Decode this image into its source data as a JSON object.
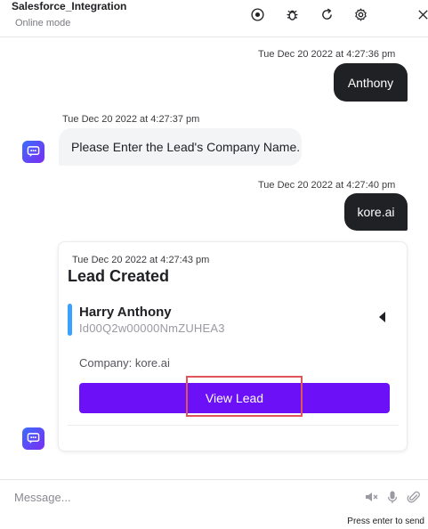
{
  "header": {
    "bot_name": "Salesforce_Integration",
    "status": "Online mode",
    "icons": [
      "record-icon",
      "bug-icon",
      "refresh-icon",
      "settings-icon",
      "close-icon"
    ]
  },
  "messages": {
    "m1": {
      "sender": "user",
      "timestamp": "Tue Dec 20 2022 at 4:27:36 pm",
      "text": "Anthony"
    },
    "m2": {
      "sender": "bot",
      "timestamp": "Tue Dec 20 2022 at 4:27:37 pm",
      "text": "Please Enter the Lead's Company Name."
    },
    "m3": {
      "sender": "user",
      "timestamp": "Tue Dec 20 2022 at 4:27:40 pm",
      "text": "kore.ai"
    }
  },
  "card": {
    "timestamp": "Tue Dec 20 2022 at 4:27:43 pm",
    "title": "Lead Created",
    "lead_name": "Harry Anthony",
    "lead_id": "Id00Q2w00000NmZUHEA3",
    "company": "Company: kore.ai",
    "button_label": "View Lead"
  },
  "composer": {
    "placeholder": "Message...",
    "hint": "Press enter to send"
  },
  "colors": {
    "user_bubble": "#202124",
    "bot_bubble": "#f3f4f6",
    "button": "#6c10f7",
    "highlight": "#e0545a",
    "lead_accent": "#3ba1ff"
  }
}
